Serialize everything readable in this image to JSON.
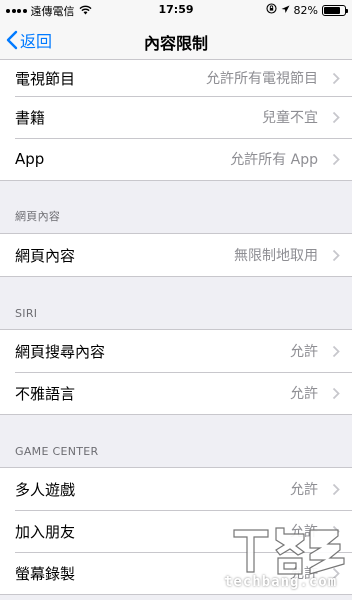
{
  "status_bar": {
    "carrier": "遠傳電信",
    "time": "17:59",
    "battery": "82%",
    "battery_level": 0.82
  },
  "nav": {
    "back_label": "返回",
    "title": "內容限制"
  },
  "media_group": [
    {
      "label": "電視節目",
      "value": "允許所有電視節目"
    },
    {
      "label": "書籍",
      "value": "兒童不宜"
    },
    {
      "label": "App",
      "value": "允許所有 App"
    }
  ],
  "web_section": {
    "header": "網頁內容",
    "rows": [
      {
        "label": "網頁內容",
        "value": "無限制地取用"
      }
    ]
  },
  "siri_section": {
    "header": "SIRI",
    "rows": [
      {
        "label": "網頁搜尋內容",
        "value": "允許"
      },
      {
        "label": "不雅語言",
        "value": "允許"
      }
    ]
  },
  "game_center_section": {
    "header": "GAME CENTER",
    "rows": [
      {
        "label": "多人遊戲",
        "value": "允許"
      },
      {
        "label": "加入朋友",
        "value": "允許"
      },
      {
        "label": "螢幕錄製",
        "value": "允許"
      }
    ]
  },
  "watermark": {
    "logo": "T客邦",
    "url": "techbang.com"
  },
  "colors": {
    "accent": "#007aff",
    "background": "#efeff4",
    "secondary_text": "#8e8e93",
    "separator": "#c8c7cc"
  },
  "icons": [
    "signal-icon",
    "wifi-icon",
    "orientation-lock-icon",
    "location-icon",
    "battery-icon",
    "chevron-left-icon",
    "chevron-right-icon"
  ]
}
